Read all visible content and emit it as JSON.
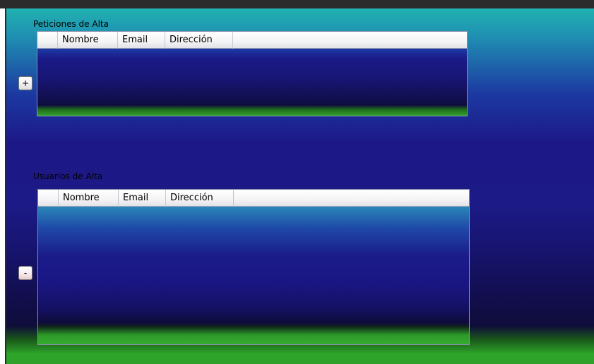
{
  "peticiones": {
    "title": "Peticiones de Alta",
    "columns": [
      "Nombre",
      "Email",
      "Dirección"
    ],
    "add_button_label": "+"
  },
  "usuarios": {
    "title": "Usuarios de Alta",
    "columns": [
      "Nombre",
      "Email",
      "Dirección"
    ],
    "remove_button_label": "-"
  },
  "colors": {
    "top_bar": "#2b2b2b",
    "background_top": "#20b2b0",
    "background_mid": "#1d1888",
    "background_bottom": "#2fa12b"
  }
}
